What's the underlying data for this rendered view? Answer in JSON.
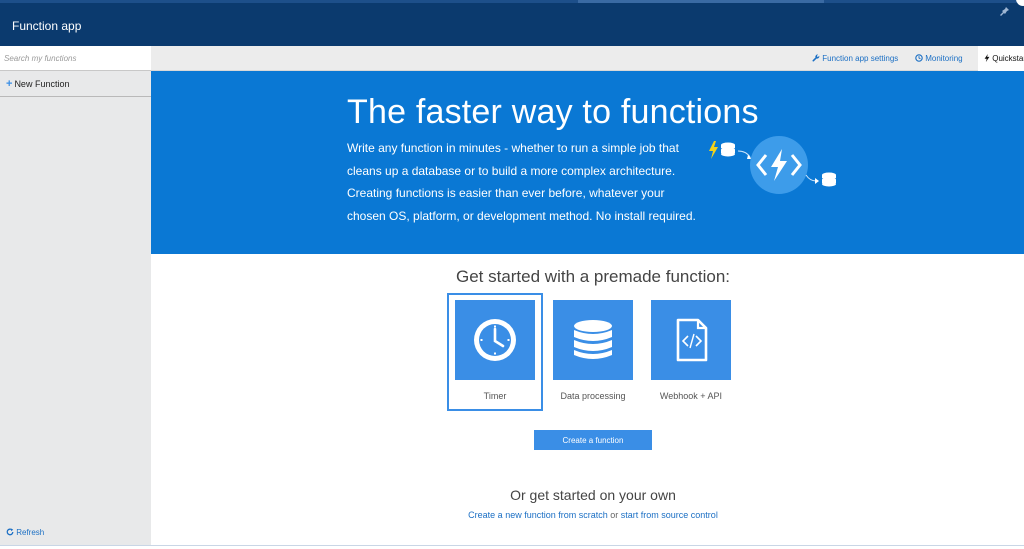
{
  "titlebar": {
    "title": "Function app"
  },
  "sidebar": {
    "search_placeholder": "Search my functions",
    "new_function": "New Function",
    "refresh": "Refresh"
  },
  "toolbar": {
    "settings": "Function app settings",
    "monitoring": "Monitoring",
    "quickstart": "Quickstart"
  },
  "hero": {
    "title": "The faster way to functions",
    "description": "Write any function in minutes - whether to run a simple job that cleans up a database or to build a more complex architecture. Creating functions is easier than ever before, whatever your chosen OS, platform, or development method. No install required."
  },
  "premade": {
    "title": "Get started with a premade function:",
    "tiles": [
      {
        "label": "Timer",
        "icon": "clock-icon",
        "selected": true
      },
      {
        "label": "Data processing",
        "icon": "database-icon",
        "selected": false
      },
      {
        "label": "Webhook + API",
        "icon": "code-file-icon",
        "selected": false
      }
    ],
    "create_button": "Create a function"
  },
  "own": {
    "title": "Or get started on your own",
    "link_scratch": "Create a new function from scratch",
    "separator": "or",
    "link_source": "start from source control"
  },
  "colors": {
    "header": "#0b3a6e",
    "hero": "#0a78d4",
    "accent": "#3a8ee6",
    "sidebar": "#e8e9ea",
    "bolt": "#f2d21b"
  }
}
